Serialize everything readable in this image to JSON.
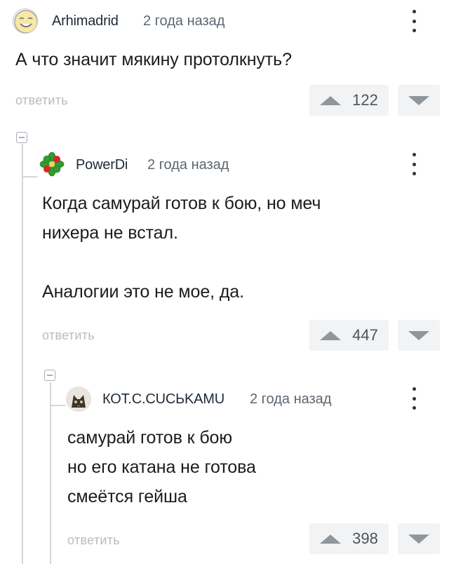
{
  "comments": [
    {
      "username": "Arhimadrid",
      "time": "2 года назад",
      "lines": [
        "А что значит мякину протолкнуть?"
      ],
      "reply_label": "ответить",
      "votes": "122",
      "avatar_icon": "smiling-face-avatar"
    },
    {
      "username": "PowerDi",
      "time": "2 года назад",
      "lines": [
        "Когда самурай готов к бою, но меч",
        "нихера не встал.",
        "",
        "Аналогии это не мое, да."
      ],
      "reply_label": "ответить",
      "votes": "447",
      "avatar_icon": "green-flower-avatar"
    },
    {
      "username": "КОТ.С.CUCЬKAMU",
      "time": "2 года назад",
      "lines": [
        "самурай готов к бою",
        "но его катана не готова",
        "смеётся гейша"
      ],
      "reply_label": "ответить",
      "votes": "398",
      "avatar_icon": "cat-photo-avatar"
    }
  ],
  "colors": {
    "text": "#1c1c1c",
    "muted": "#b6bcc2",
    "vote_bg": "#f2f3f5",
    "vote_icon": "#8f969c"
  }
}
